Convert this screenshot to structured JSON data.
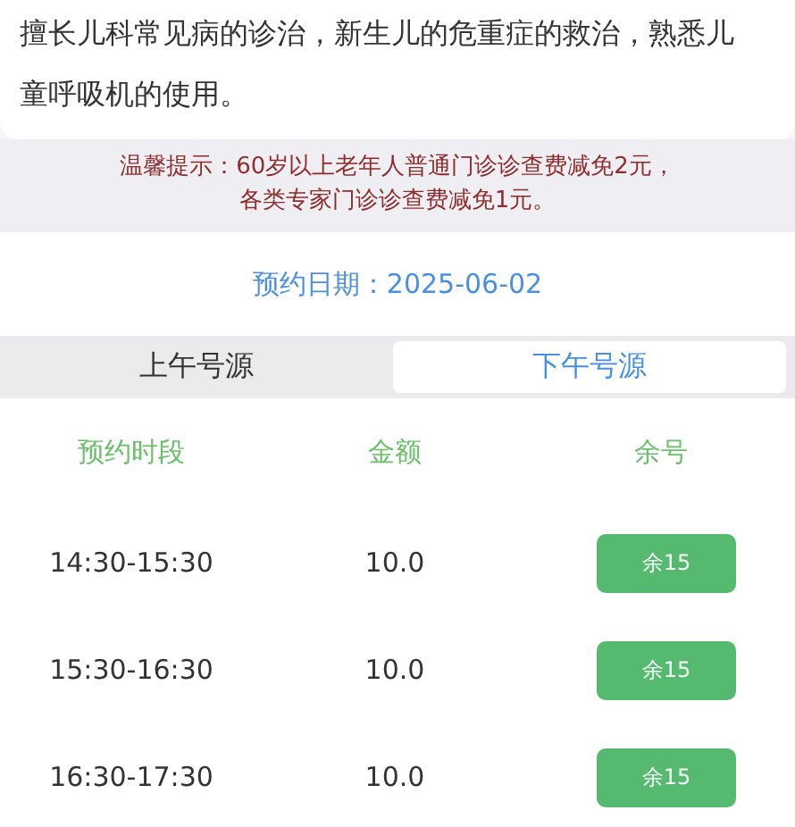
{
  "description": "擅长儿科常见病的诊治，新生儿的危重症的救治，熟悉儿童呼吸机的使用。",
  "notice": [
    "温馨提示：60岁以上老年人普通门诊诊查费减免2元，",
    "各类专家门诊诊查费减免1元。"
  ],
  "appointment_date": "预约日期：2025-06-02",
  "tabs": [
    {
      "label": "上午号源",
      "selected": false
    },
    {
      "label": "下午号源",
      "selected": true
    }
  ],
  "table": {
    "columns": [
      "预约时段",
      "金额",
      "余号"
    ],
    "rows": [
      {
        "time": "14:30-15:30",
        "amount": "10.0",
        "remaining": "余15"
      },
      {
        "time": "15:30-16:30",
        "amount": "10.0",
        "remaining": "余15"
      },
      {
        "time": "16:30-17:30",
        "amount": "10.0",
        "remaining": "余15"
      }
    ]
  }
}
